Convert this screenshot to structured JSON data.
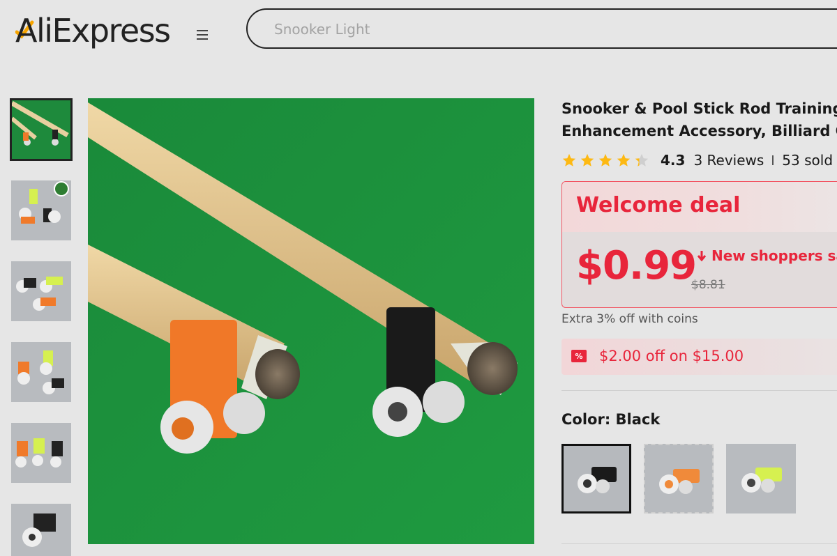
{
  "header": {
    "logo_text": "AliExpress",
    "search_placeholder": "Snooker Light"
  },
  "thumbnails": [
    {
      "name": "thumbnail-1",
      "selected": true
    },
    {
      "name": "thumbnail-2",
      "selected": false
    },
    {
      "name": "thumbnail-3",
      "selected": false
    },
    {
      "name": "thumbnail-4",
      "selected": false
    },
    {
      "name": "thumbnail-5",
      "selected": false
    },
    {
      "name": "thumbnail-6",
      "selected": false
    }
  ],
  "product": {
    "title_line1": "Snooker & Pool Stick Rod Training E",
    "title_line2": "Enhancement Accessory, Billiard Cu",
    "rating_value": "4.3",
    "stars": 4.3,
    "reviews": "3 Reviews",
    "sold": "53 sold"
  },
  "deal": {
    "title": "Welcome deal",
    "price": "$0.99",
    "new_shoppers": "New shoppers sav",
    "old_price": "$8.81"
  },
  "coins_text": "Extra 3% off with coins",
  "coupon": {
    "text": "$2.00 off on $15.00"
  },
  "color": {
    "label": "Color: Black",
    "options": [
      {
        "name": "Black",
        "selected": true
      },
      {
        "name": "Orange",
        "selected": false
      },
      {
        "name": "Yellow",
        "selected": false
      }
    ]
  },
  "colors": {
    "accent": "#e8253b",
    "table_green": "#1e8a3c",
    "wood": "#e7c98f"
  }
}
